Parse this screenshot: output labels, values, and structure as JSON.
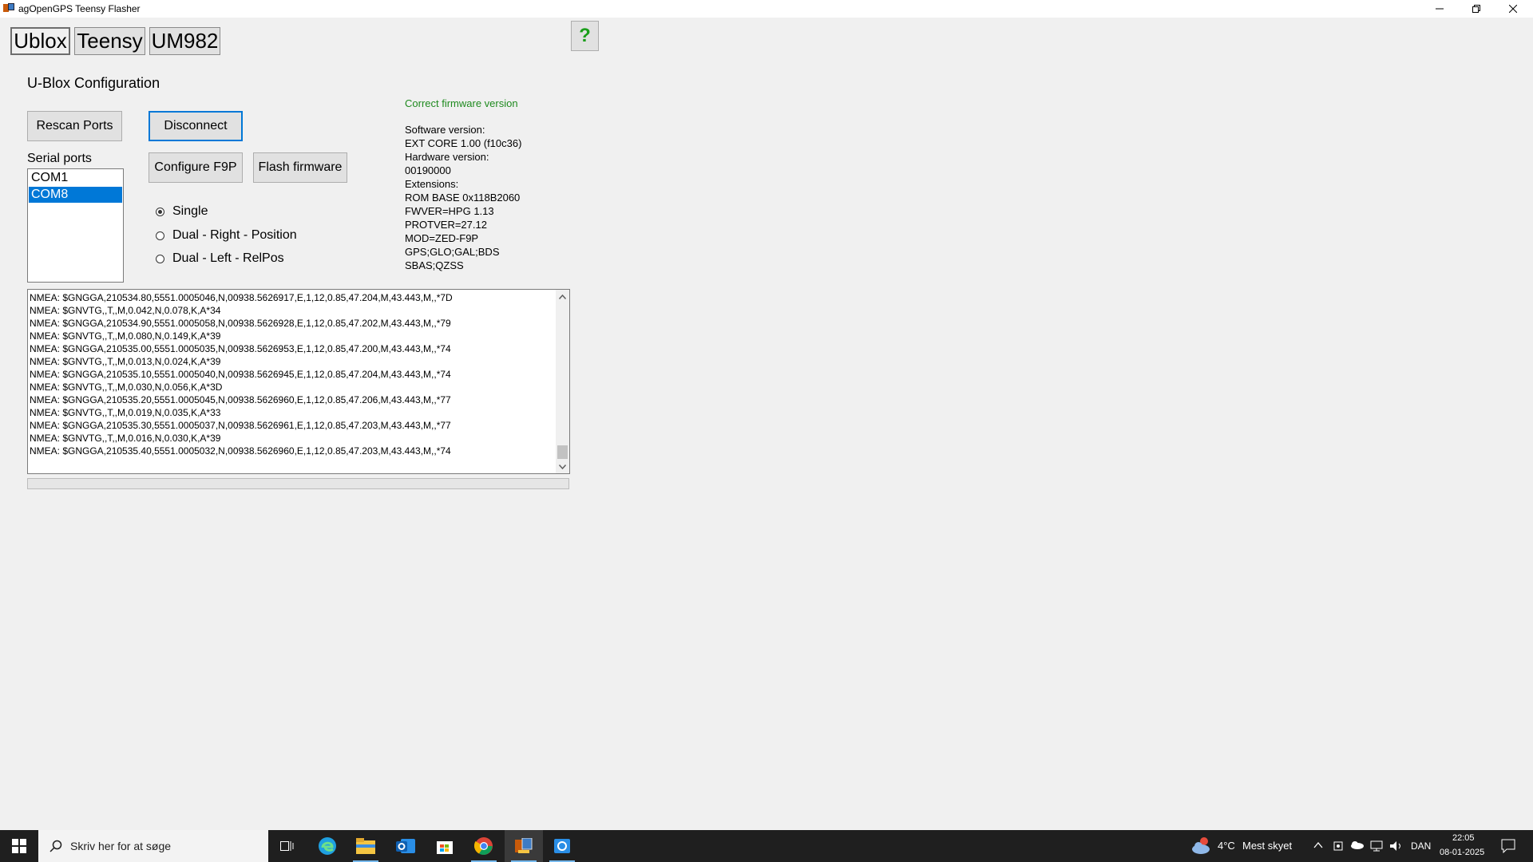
{
  "window": {
    "title": "agOpenGPS Teensy Flasher"
  },
  "tabs": [
    {
      "label": "Ublox"
    },
    {
      "label": "Teensy"
    },
    {
      "label": "UM982"
    }
  ],
  "help_label": "?",
  "section_title": "U-Blox Configuration",
  "buttons": {
    "rescan": "Rescan Ports",
    "disconnect": "Disconnect",
    "configure": "Configure F9P",
    "flash": "Flash firmware"
  },
  "serial": {
    "label": "Serial ports",
    "ports": [
      "COM1",
      "COM8"
    ],
    "selected": "COM8"
  },
  "modes": [
    {
      "label": "Single",
      "checked": true
    },
    {
      "label": "Dual - Right - Position",
      "checked": false
    },
    {
      "label": "Dual - Left - RelPos",
      "checked": false
    }
  ],
  "firmware": {
    "status": "Correct firmware version",
    "status_color": "#1f8a1f",
    "lines": [
      "Software version:",
      "EXT CORE 1.00 (f10c36)",
      "Hardware version:",
      "00190000",
      "Extensions:",
      "ROM BASE 0x118B2060",
      "FWVER=HPG 1.13",
      "PROTVER=27.12",
      "MOD=ZED-F9P",
      "GPS;GLO;GAL;BDS",
      "SBAS;QZSS"
    ]
  },
  "log": [
    "NMEA: $GNGGA,210534.80,5551.0005046,N,00938.5626917,E,1,12,0.85,47.204,M,43.443,M,,*7D",
    "NMEA: $GNVTG,,T,,M,0.042,N,0.078,K,A*34",
    "NMEA: $GNGGA,210534.90,5551.0005058,N,00938.5626928,E,1,12,0.85,47.202,M,43.443,M,,*79",
    "NMEA: $GNVTG,,T,,M,0.080,N,0.149,K,A*39",
    "NMEA: $GNGGA,210535.00,5551.0005035,N,00938.5626953,E,1,12,0.85,47.200,M,43.443,M,,*74",
    "NMEA: $GNVTG,,T,,M,0.013,N,0.024,K,A*39",
    "NMEA: $GNGGA,210535.10,5551.0005040,N,00938.5626945,E,1,12,0.85,47.204,M,43.443,M,,*74",
    "NMEA: $GNVTG,,T,,M,0.030,N,0.056,K,A*3D",
    "NMEA: $GNGGA,210535.20,5551.0005045,N,00938.5626960,E,1,12,0.85,47.206,M,43.443,M,,*77",
    "NMEA: $GNVTG,,T,,M,0.019,N,0.035,K,A*33",
    "NMEA: $GNGGA,210535.30,5551.0005037,N,00938.5626961,E,1,12,0.85,47.203,M,43.443,M,,*77",
    "NMEA: $GNVTG,,T,,M,0.016,N,0.030,K,A*39",
    "NMEA: $GNGGA,210535.40,5551.0005032,N,00938.5626960,E,1,12,0.85,47.203,M,43.443,M,,*74"
  ],
  "progress": 0,
  "taskbar": {
    "search_placeholder": "Skriv her for at søge",
    "weather_temp": "4°C",
    "weather_text": "Mest skyet",
    "language": "DAN",
    "time": "22:05",
    "date": "08-01-2025",
    "apps": [
      "task-view-icon",
      "edge-icon",
      "file-explorer-icon",
      "outlook-icon",
      "store-icon",
      "chrome-icon",
      "flasher-app-icon",
      "remote-app-icon"
    ]
  }
}
